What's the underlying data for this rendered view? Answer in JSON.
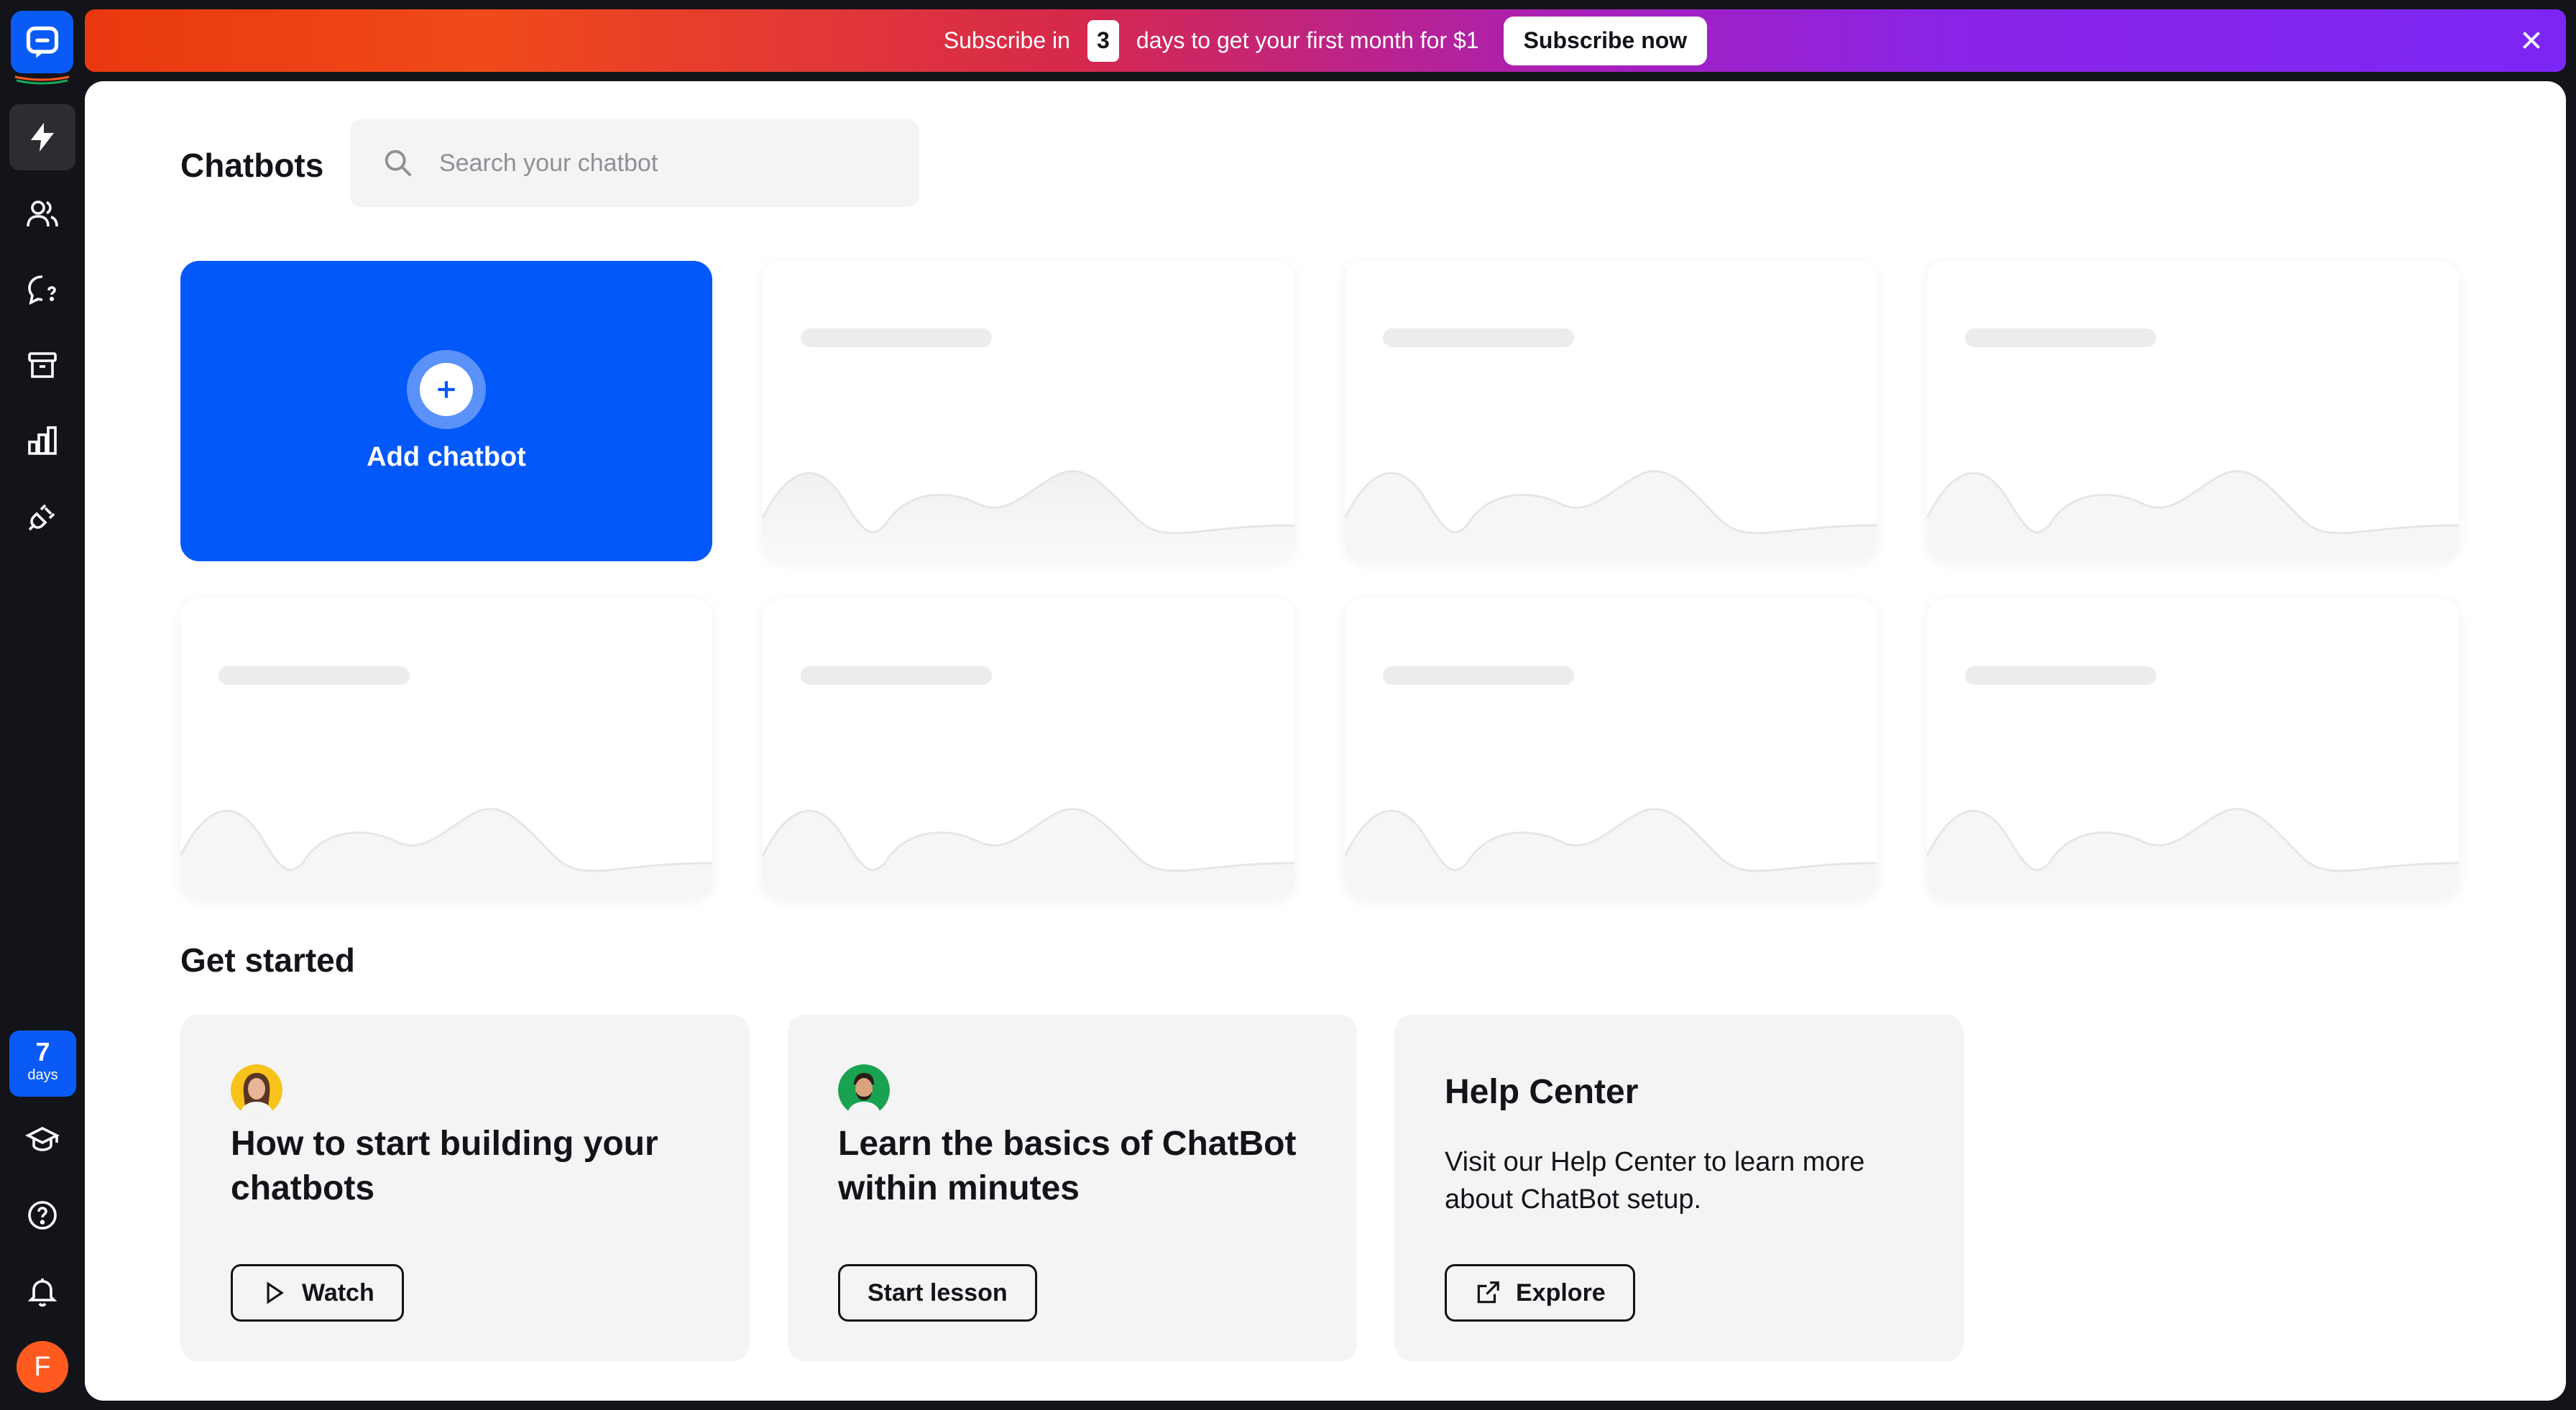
{
  "banner": {
    "text_before": "Subscribe in",
    "days": "3",
    "text_after": "days to get your first month for $1",
    "button": "Subscribe now"
  },
  "sidebar": {
    "trial_days": "7",
    "trial_label": "days",
    "avatar_letter": "F"
  },
  "header": {
    "title": "Chatbots",
    "search_placeholder": "Search your chatbot"
  },
  "add_chatbot": {
    "label": "Add chatbot"
  },
  "get_started": {
    "title": "Get started",
    "cards": [
      {
        "title": "How to start building your chatbots",
        "button": "Watch"
      },
      {
        "title": "Learn the basics of ChatBot within minutes",
        "button": "Start lesson"
      },
      {
        "title": "Help Center",
        "description": "Visit our Help Center to learn more about ChatBot setup.",
        "button": "Explore"
      }
    ]
  },
  "colors": {
    "brand_blue": "#0258f8",
    "sidebar_bg": "#131419",
    "avatar_orange": "#ff5a1f"
  }
}
